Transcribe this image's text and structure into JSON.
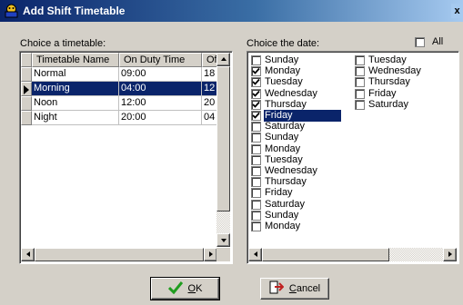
{
  "window": {
    "title": "Add Shift Timetable",
    "close_glyph": "x"
  },
  "timetable": {
    "label": "Choice a timetable:",
    "columns": [
      "Timetable Name",
      "On Duty Time",
      "Of"
    ],
    "rows": [
      {
        "name": "Normal",
        "on_duty": "09:00",
        "off": "18",
        "selected": false
      },
      {
        "name": "Morning",
        "on_duty": "04:00",
        "off": "12",
        "selected": true
      },
      {
        "name": "Noon",
        "on_duty": "12:00",
        "off": "20",
        "selected": false
      },
      {
        "name": "Night",
        "on_duty": "20:00",
        "off": "04",
        "selected": false
      }
    ]
  },
  "dates": {
    "label": "Choice the date:",
    "all_label": "All",
    "all_checked": false,
    "col1": [
      {
        "label": "Sunday",
        "checked": false,
        "selected": false
      },
      {
        "label": "Monday",
        "checked": true,
        "selected": false
      },
      {
        "label": "Tuesday",
        "checked": true,
        "selected": false
      },
      {
        "label": "Wednesday",
        "checked": true,
        "selected": false
      },
      {
        "label": "Thursday",
        "checked": true,
        "selected": false
      },
      {
        "label": "Friday",
        "checked": true,
        "selected": true
      },
      {
        "label": "Saturday",
        "checked": false,
        "selected": false
      },
      {
        "label": "Sunday",
        "checked": false,
        "selected": false
      },
      {
        "label": "Monday",
        "checked": false,
        "selected": false
      },
      {
        "label": "Tuesday",
        "checked": false,
        "selected": false
      },
      {
        "label": "Wednesday",
        "checked": false,
        "selected": false
      },
      {
        "label": "Thursday",
        "checked": false,
        "selected": false
      },
      {
        "label": "Friday",
        "checked": false,
        "selected": false
      },
      {
        "label": "Saturday",
        "checked": false,
        "selected": false
      },
      {
        "label": "Sunday",
        "checked": false,
        "selected": false
      },
      {
        "label": "Monday",
        "checked": false,
        "selected": false
      }
    ],
    "col2": [
      {
        "label": "Tuesday",
        "checked": false,
        "selected": false
      },
      {
        "label": "Wednesday",
        "checked": false,
        "selected": false
      },
      {
        "label": "Thursday",
        "checked": false,
        "selected": false
      },
      {
        "label": "Friday",
        "checked": false,
        "selected": false
      },
      {
        "label": "Saturday",
        "checked": false,
        "selected": false
      }
    ]
  },
  "buttons": {
    "ok": "OK",
    "cancel": "Cancel"
  },
  "colors": {
    "selection": "#0a246a",
    "ok_check": "#1f9d1f",
    "cancel_icon": "#c02020"
  }
}
